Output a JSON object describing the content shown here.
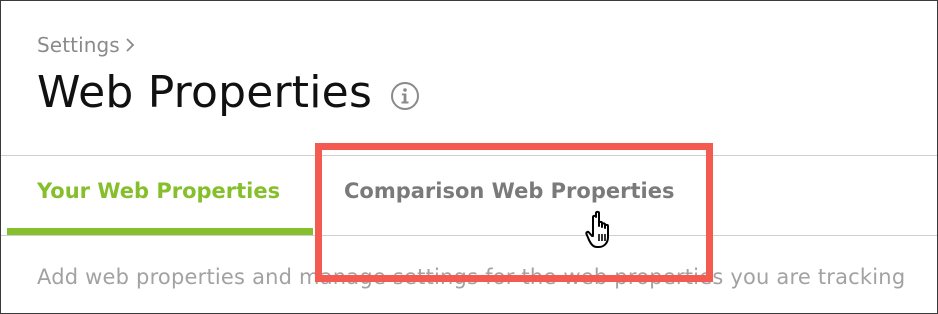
{
  "breadcrumb": {
    "label": "Settings"
  },
  "page": {
    "title": "Web Properties"
  },
  "tabs": [
    {
      "label": "Your Web Properties",
      "active": true
    },
    {
      "label": "Comparison Web Properties",
      "active": false
    }
  ],
  "description": "Add web properties and manage settings for the web properties you are tracking",
  "colors": {
    "accent": "#86bf2c",
    "highlight": "#f45a50",
    "inactive_tab": "#7a7a7a",
    "muted_text": "#a2a2a2"
  },
  "icons": {
    "breadcrumb": "chevron-right-icon",
    "title": "info-icon",
    "pointer": "hand-pointer-icon"
  }
}
